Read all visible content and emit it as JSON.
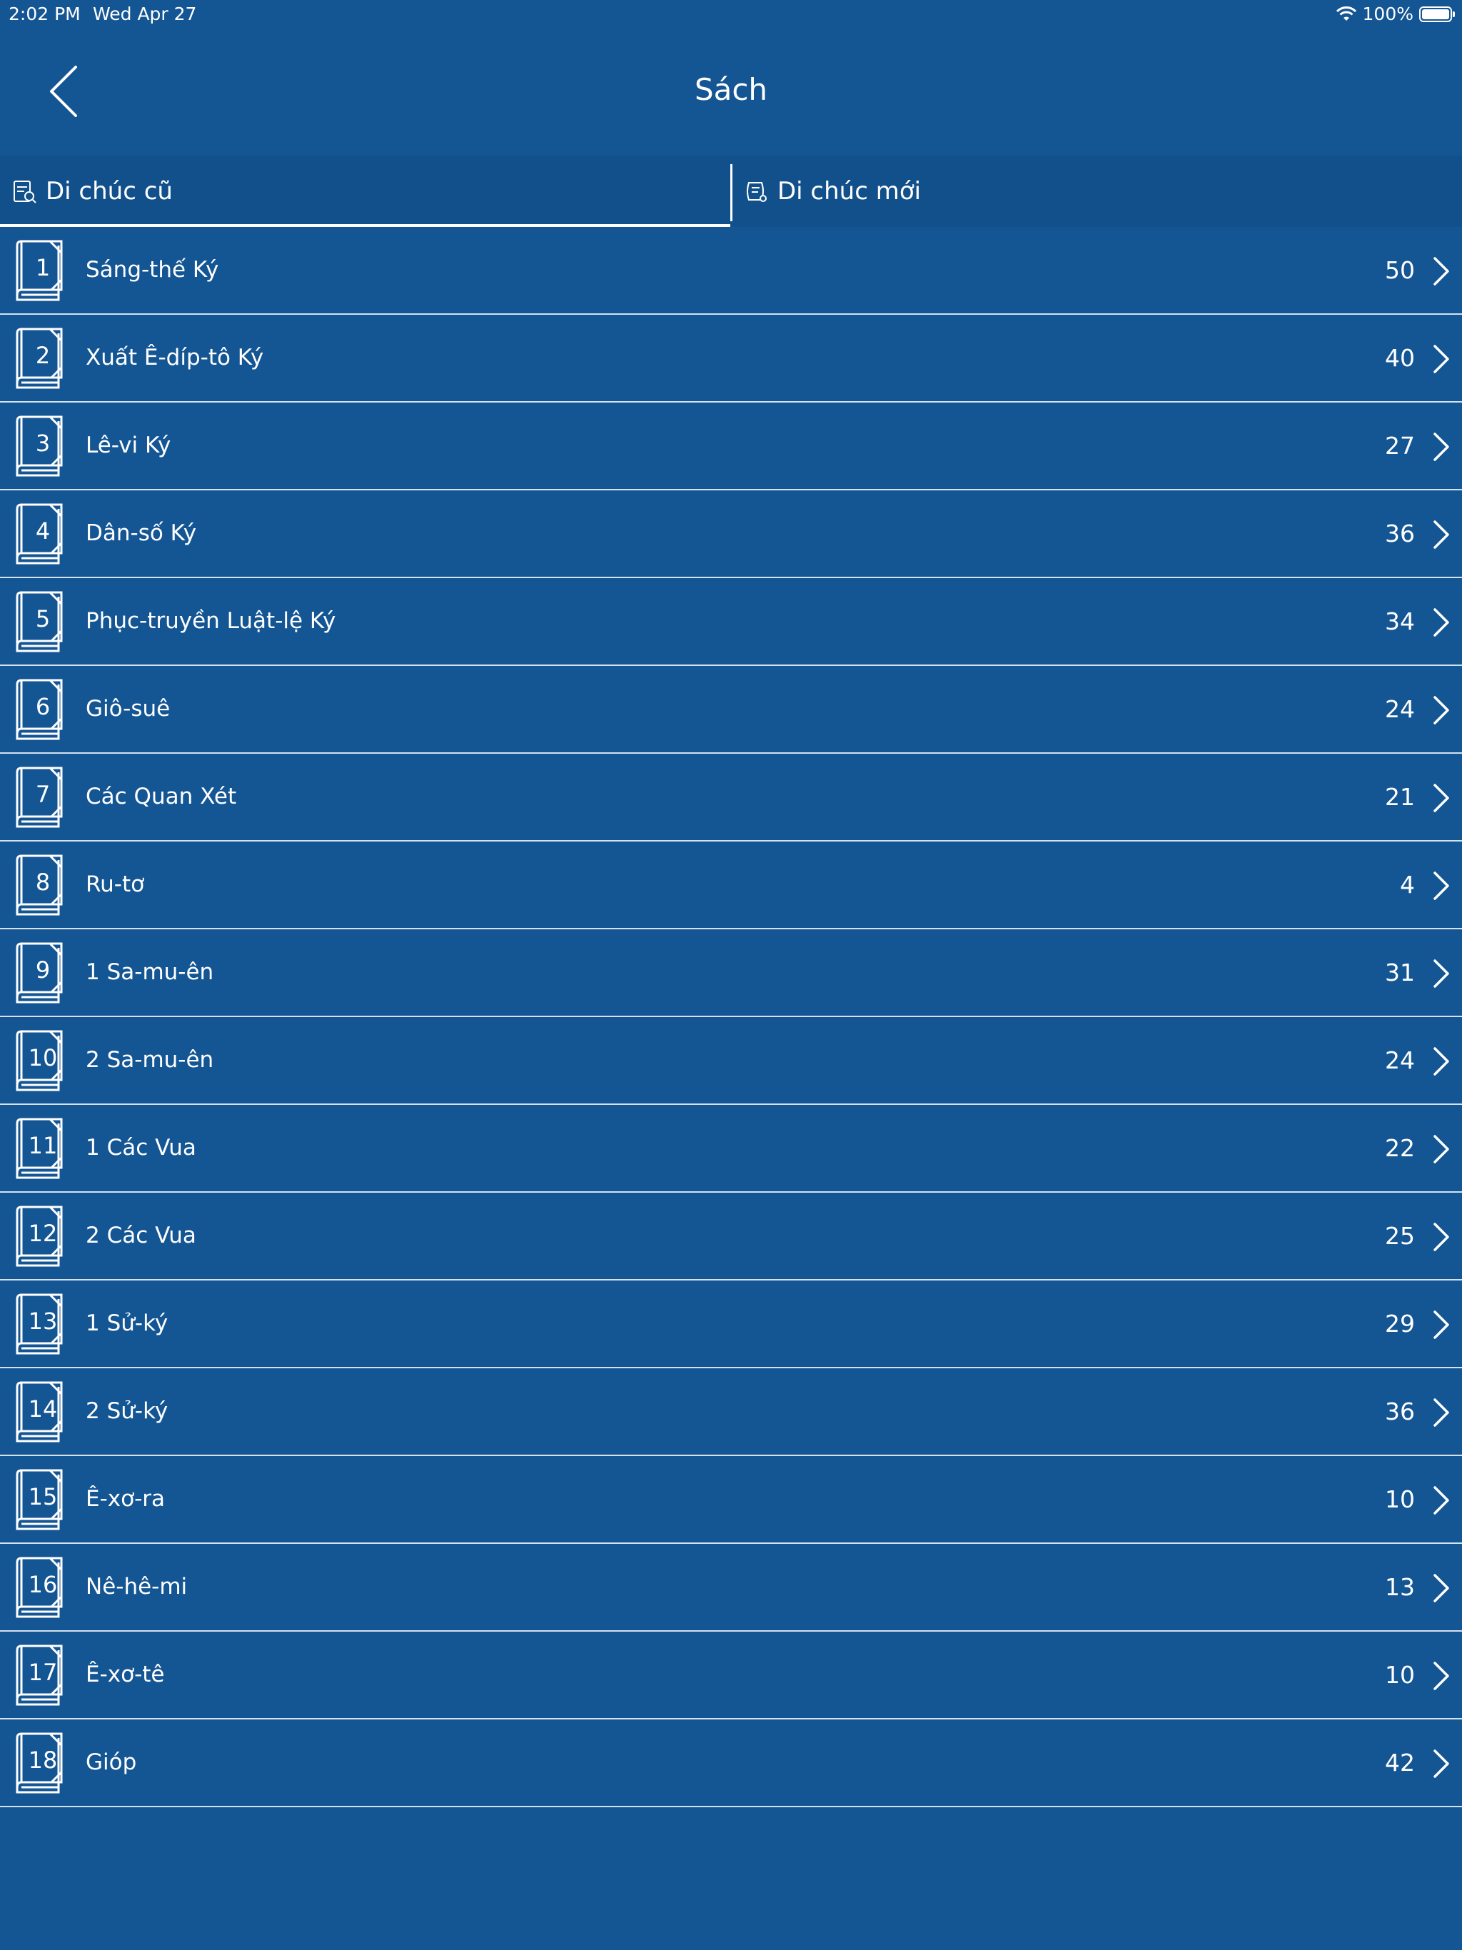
{
  "status": {
    "time": "2:02 PM",
    "date": "Wed Apr 27",
    "battery": "100%"
  },
  "nav": {
    "title": "Sách"
  },
  "tabs": [
    {
      "label": "Di chúc cũ",
      "icon": "old-testament-icon",
      "selected": true
    },
    {
      "label": "Di chúc mới",
      "icon": "new-testament-icon",
      "selected": false
    }
  ],
  "books": [
    {
      "num": "1",
      "name": "Sáng-thế Ký",
      "chapters": "50"
    },
    {
      "num": "2",
      "name": "Xuất Ê-díp-tô Ký",
      "chapters": "40"
    },
    {
      "num": "3",
      "name": "Lê-vi Ký",
      "chapters": "27"
    },
    {
      "num": "4",
      "name": "Dân-số Ký",
      "chapters": "36"
    },
    {
      "num": "5",
      "name": "Phục-truyền Luật-lệ Ký",
      "chapters": "34"
    },
    {
      "num": "6",
      "name": "Giô-suê",
      "chapters": "24"
    },
    {
      "num": "7",
      "name": "Các Quan Xét",
      "chapters": "21"
    },
    {
      "num": "8",
      "name": "Ru-tơ",
      "chapters": "4"
    },
    {
      "num": "9",
      "name": "1 Sa-mu-ên",
      "chapters": "31"
    },
    {
      "num": "10",
      "name": "2 Sa-mu-ên",
      "chapters": "24"
    },
    {
      "num": "11",
      "name": "1 Các Vua",
      "chapters": "22"
    },
    {
      "num": "12",
      "name": "2 Các Vua",
      "chapters": "25"
    },
    {
      "num": "13",
      "name": "1 Sử-ký",
      "chapters": "29"
    },
    {
      "num": "14",
      "name": "2 Sử-ký",
      "chapters": "36"
    },
    {
      "num": "15",
      "name": "Ê-xơ-ra",
      "chapters": "10"
    },
    {
      "num": "16",
      "name": "Nê-hê-mi",
      "chapters": "13"
    },
    {
      "num": "17",
      "name": "Ê-xơ-tê",
      "chapters": "10"
    },
    {
      "num": "18",
      "name": "Gióp",
      "chapters": "42"
    }
  ]
}
